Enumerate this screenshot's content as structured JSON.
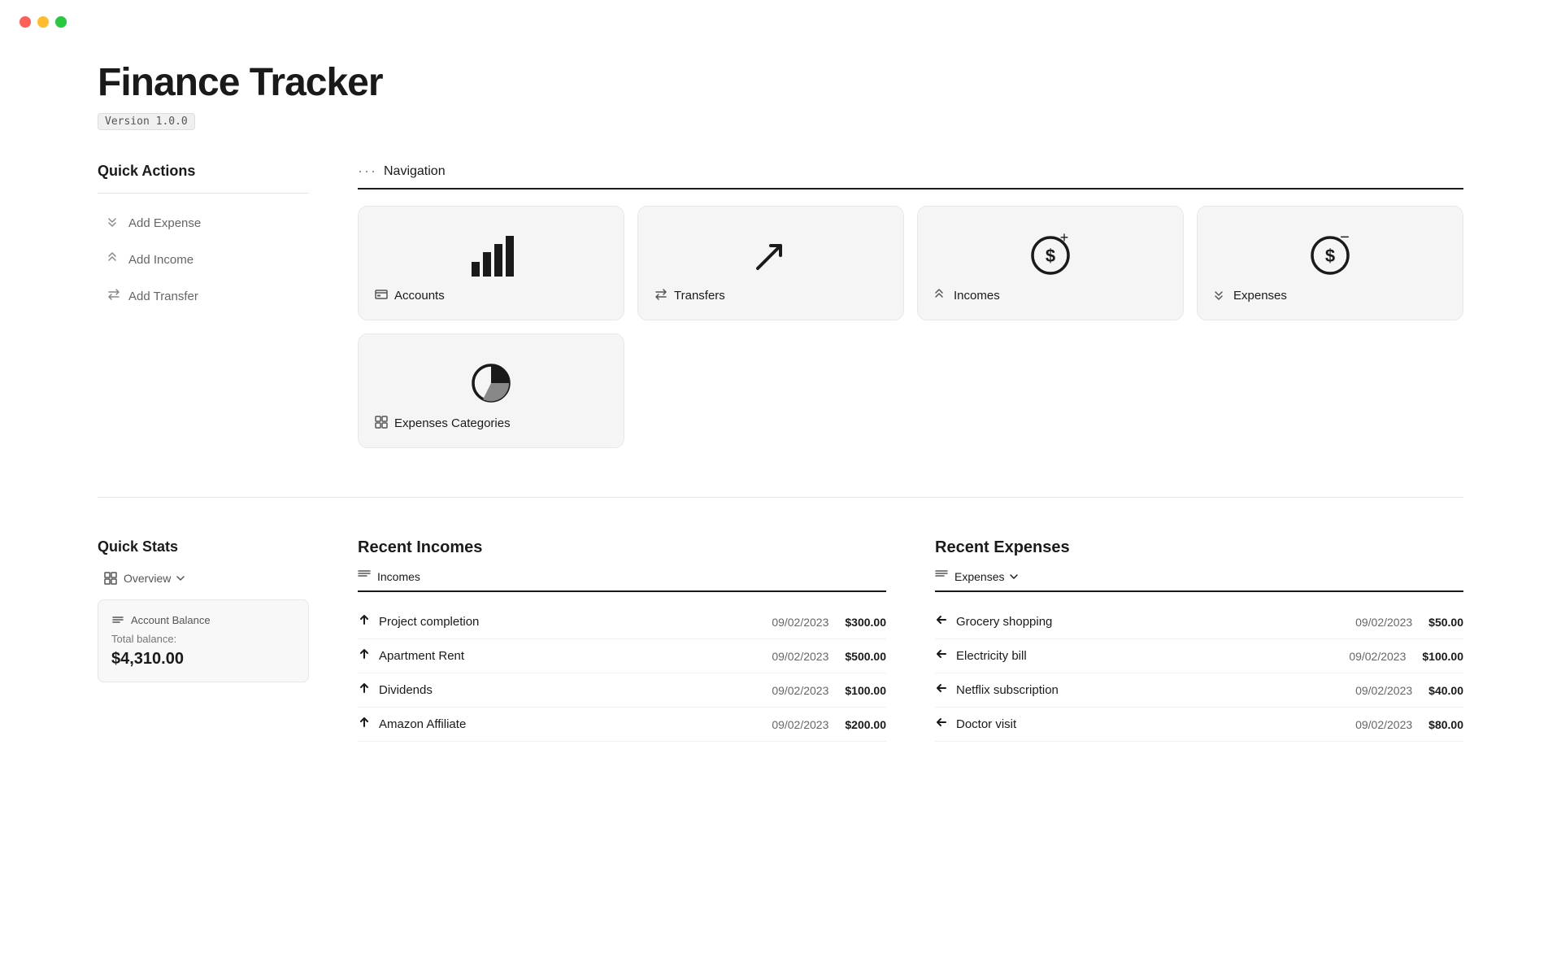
{
  "app": {
    "title": "Finance Tracker",
    "version": "Version 1.0.0"
  },
  "quick_actions": {
    "title": "Quick Actions",
    "buttons": [
      {
        "label": "Add Expense",
        "icon": "chevron-down"
      },
      {
        "label": "Add Income",
        "icon": "chevron-up"
      },
      {
        "label": "Add Transfer",
        "icon": "transfer"
      }
    ]
  },
  "navigation": {
    "title": "Navigation",
    "cards": [
      {
        "label": "Accounts",
        "label_icon": "bank"
      },
      {
        "label": "Transfers",
        "label_icon": "transfer"
      },
      {
        "label": "Incomes",
        "label_icon": "income"
      },
      {
        "label": "Expenses",
        "label_icon": "expense"
      },
      {
        "label": "Expenses Categories",
        "label_icon": "layers"
      }
    ]
  },
  "quick_stats": {
    "title": "Quick Stats",
    "overview_label": "Overview",
    "account_balance": {
      "title": "Account Balance",
      "label": "Total balance:",
      "value": "$4,310.00"
    }
  },
  "recent_incomes": {
    "title": "Recent Incomes",
    "tab_label": "Incomes",
    "items": [
      {
        "name": "Project completion",
        "date": "09/02/2023",
        "amount": "$300.00"
      },
      {
        "name": "Apartment Rent",
        "date": "09/02/2023",
        "amount": "$500.00"
      },
      {
        "name": "Dividends",
        "date": "09/02/2023",
        "amount": "$100.00"
      },
      {
        "name": "Amazon Affiliate",
        "date": "09/02/2023",
        "amount": "$200.00"
      }
    ]
  },
  "recent_expenses": {
    "title": "Recent Expenses",
    "tab_label": "Expenses",
    "items": [
      {
        "name": "Grocery shopping",
        "date": "09/02/2023",
        "amount": "$50.00"
      },
      {
        "name": "Electricity bill",
        "date": "09/02/2023",
        "amount": "$100.00"
      },
      {
        "name": "Netflix subscription",
        "date": "09/02/2023",
        "amount": "$40.00"
      },
      {
        "name": "Doctor visit",
        "date": "09/02/2023",
        "amount": "$80.00"
      }
    ]
  }
}
